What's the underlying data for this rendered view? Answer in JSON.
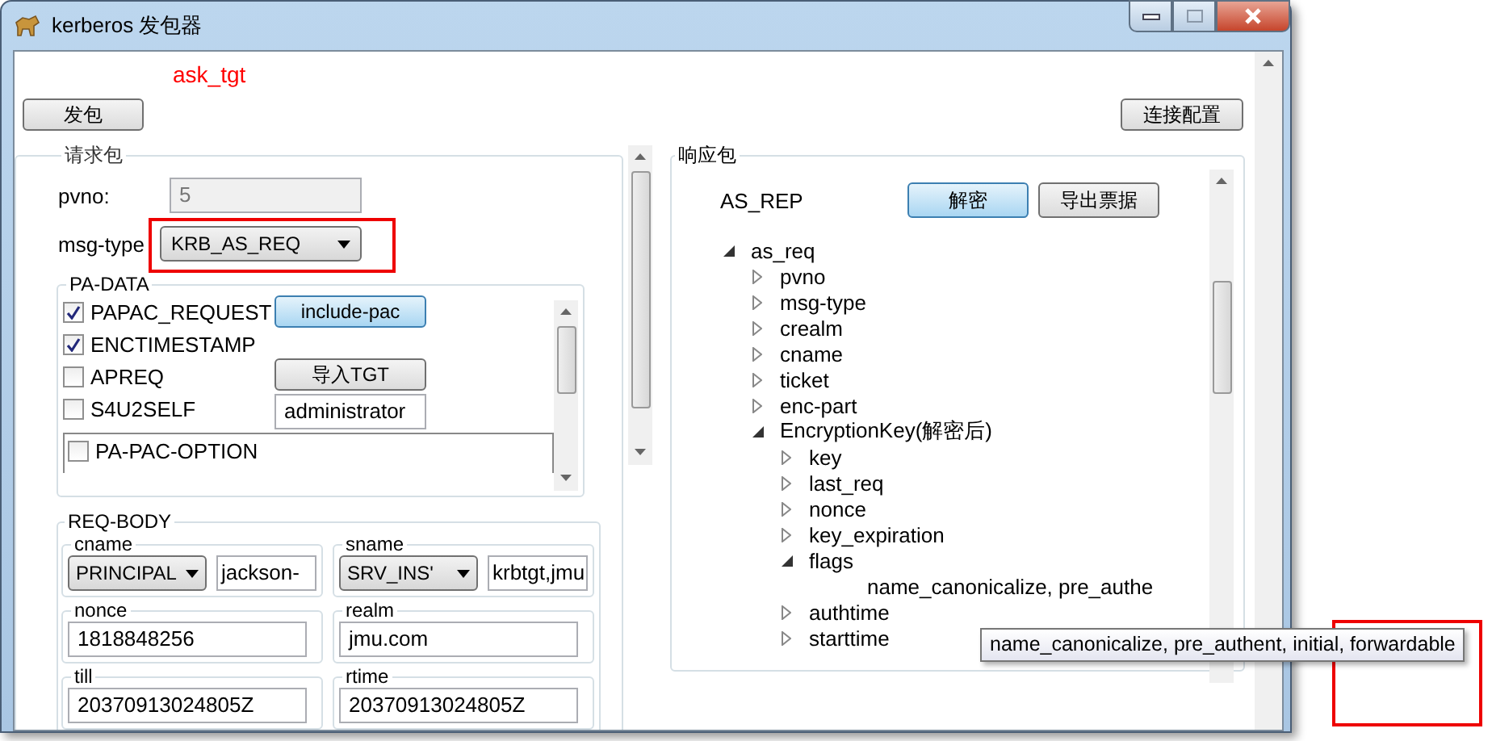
{
  "window": {
    "title": "kerberos 发包器"
  },
  "mode_label": "ask_tgt",
  "send_button": "发包",
  "config_button": "连接配置",
  "request": {
    "title": "请求包",
    "pvno": {
      "label": "pvno:",
      "value": "5",
      "disabled": true
    },
    "msg_type": {
      "label": "msg-type",
      "value": "KRB_AS_REQ"
    },
    "pa_data": {
      "title": "PA-DATA",
      "options": [
        {
          "label": "PAPAC_REQUEST",
          "checked": true
        },
        {
          "label": "ENCTIMESTAMP",
          "checked": true
        },
        {
          "label": "APREQ",
          "checked": false
        },
        {
          "label": "S4U2SELF",
          "checked": false
        }
      ],
      "include_pac": {
        "label": "include-pac",
        "active": true
      },
      "import_tgt": {
        "label": "导入TGT",
        "active": false
      },
      "user_field": "administrator",
      "pac_option": {
        "label": "PA-PAC-OPTION",
        "checked": false
      }
    },
    "req_body": {
      "title": "REQ-BODY",
      "names": [
        {
          "label": "cname",
          "type": "PRINCIPAL",
          "value": "jackson-"
        },
        {
          "label": "sname",
          "type": "SRV_INS'",
          "value": "krbtgt,jmu"
        }
      ],
      "fields": [
        {
          "label": "nonce",
          "value": "1818848256"
        },
        {
          "label": "realm",
          "value": "jmu.com"
        },
        {
          "label": "till",
          "value": "20370913024805Z"
        },
        {
          "label": "rtime",
          "value": "20370913024805Z"
        }
      ]
    }
  },
  "response": {
    "title": "响应包",
    "type": "AS_REP",
    "decrypt": {
      "label": "解密",
      "active": true
    },
    "export": {
      "label": "导出票据",
      "active": false
    },
    "tree": [
      {
        "label": "as_req",
        "expanded": true,
        "children": [
          {
            "label": "pvno",
            "expanded": false
          },
          {
            "label": "msg-type",
            "expanded": false
          },
          {
            "label": "crealm",
            "expanded": false
          },
          {
            "label": "cname",
            "expanded": false
          },
          {
            "label": "ticket",
            "expanded": false
          },
          {
            "label": "enc-part",
            "expanded": false
          },
          {
            "label": "EncryptionKey(解密后)",
            "expanded": true,
            "children": [
              {
                "label": "key",
                "expanded": false
              },
              {
                "label": "last_req",
                "expanded": false
              },
              {
                "label": "nonce",
                "expanded": false
              },
              {
                "label": "key_expiration",
                "expanded": false
              },
              {
                "label": "flags",
                "expanded": true,
                "children": [
                  {
                    "label": "name_canonicalize, pre_authe"
                  }
                ]
              },
              {
                "label": "authtime",
                "expanded": false
              },
              {
                "label": "starttime",
                "expanded": false
              }
            ]
          }
        ]
      }
    ]
  },
  "tooltip": "name_canonicalize, pre_authent, initial, forwardable"
}
